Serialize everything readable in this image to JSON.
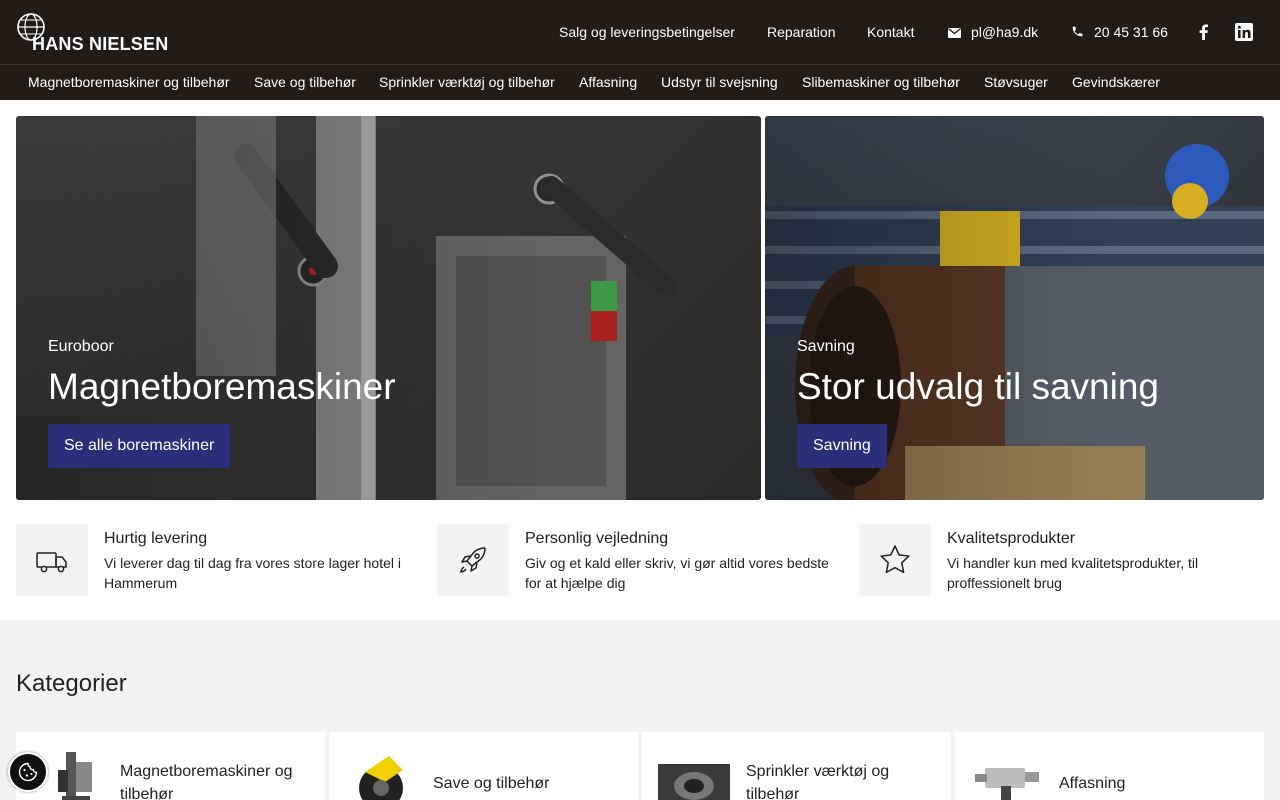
{
  "brand": {
    "name": "HANS NIELSEN"
  },
  "topbar": {
    "links": [
      "Salg og leveringsbetingelser",
      "Reparation",
      "Kontakt"
    ],
    "email": "pl@ha9.dk",
    "phone": "20 45 31 66",
    "icons": {
      "email": "envelope-icon",
      "phone": "phone-icon",
      "facebook": "facebook-icon",
      "linkedin": "linkedin-icon"
    }
  },
  "nav": {
    "items": [
      "Magnetboremaskiner og tilbehør",
      "Save og tilbehør",
      "Sprinkler værktøj og tilbehør",
      "Affasning",
      "Udstyr til svejsning",
      "Slibemaskiner og tilbehør",
      "Støvsuger",
      "Gevindskærer"
    ]
  },
  "hero": [
    {
      "eyebrow": "Euroboor",
      "title": "Magnetboremaskiner",
      "button": "Se alle boremaskiner"
    },
    {
      "eyebrow": "Savning",
      "title": "Stor udvalg til savning",
      "button": "Savning"
    }
  ],
  "features": [
    {
      "icon": "truck-icon",
      "title": "Hurtig levering",
      "desc": "Vi leverer dag til dag fra vores store lager hotel i Hammerum"
    },
    {
      "icon": "rocket-icon",
      "title": "Personlig vejledning",
      "desc": "Giv og et kald eller skriv, vi gør altid vores bedste for at hjælpe dig"
    },
    {
      "icon": "star-icon",
      "title": "Kvalitetsprodukter",
      "desc": "Vi handler kun med kvalitetsprodukter, til proffessionelt brug"
    }
  ],
  "categories": {
    "heading": "Kategorier",
    "items": [
      {
        "label": "Magnetboremaskiner og tilbehør"
      },
      {
        "label": "Save og tilbehør"
      },
      {
        "label": "Sprinkler værktøj og tilbehør"
      },
      {
        "label": "Affasning"
      }
    ]
  },
  "colors": {
    "dark": "#201c1a",
    "accent": "#2b2f7a",
    "light": "#f4f3f2"
  }
}
